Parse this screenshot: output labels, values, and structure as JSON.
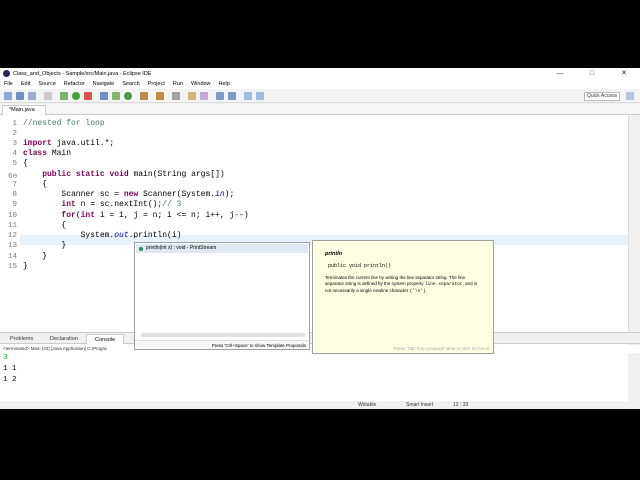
{
  "window": {
    "title": "Class_and_Objects - Sample/src/Main.java - Eclipse IDE",
    "minimize": "—",
    "maximize": "□",
    "close": "✕"
  },
  "menu": [
    "File",
    "Edit",
    "Source",
    "Refactor",
    "Navigate",
    "Search",
    "Project",
    "Run",
    "Window",
    "Help"
  ],
  "toolbar": {
    "quick_access": "Quick Access"
  },
  "editor": {
    "tab_label": "*Main.java",
    "lines": [
      {
        "no": "1",
        "text": "//nested for loop"
      },
      {
        "no": "2",
        "text": ""
      },
      {
        "no": "3",
        "text": "import java.util.*;"
      },
      {
        "no": "4",
        "text": "class Main"
      },
      {
        "no": "5",
        "text": "{"
      },
      {
        "no": "6⊖",
        "text": "    public static void main(String args[])"
      },
      {
        "no": "7",
        "text": "    {"
      },
      {
        "no": "8",
        "text": "        Scanner sc = new Scanner(System.in);"
      },
      {
        "no": "9",
        "text": "        int n = sc.nextInt();// 3"
      },
      {
        "no": "10",
        "text": "        for(int i = 1, j = n; i <= n; i++, j--)"
      },
      {
        "no": "11",
        "text": "        {"
      },
      {
        "no": "12",
        "text": "            System.out.println(i)"
      },
      {
        "no": "13",
        "text": "        }"
      },
      {
        "no": "14",
        "text": "    }"
      },
      {
        "no": "15",
        "text": "}"
      }
    ]
  },
  "proposals": {
    "selected": "println(int x) : void - PrintStream",
    "footer": "Press 'Ctrl+Space' to show Template Proposals"
  },
  "javadoc": {
    "title": "println",
    "signature": "public void println()",
    "desc_1": "Terminates the current line by writing the line separator string. The line separator string is defined by the system property",
    "desc_prop": "line.separator",
    "desc_2": ", and is not necessarily a single newline character",
    "desc_char": "('\\n')",
    "desc_end": ".",
    "footer": "Press 'Tab' from proposal table or click for focus"
  },
  "console": {
    "tabs": [
      "Problems",
      "Declaration",
      "Console"
    ],
    "active_tab": "Console",
    "status": "<terminated> Main (33) [Java Application] C:\\Progra",
    "output": [
      {
        "text": "3",
        "input": true
      },
      {
        "text": "1 1",
        "input": false
      },
      {
        "text": "1 2",
        "input": false
      }
    ]
  },
  "statusbar": {
    "writable": "Writable",
    "insert_mode": "Smart Insert",
    "position": "12 : 33"
  },
  "colors": {
    "keyword": "#7f0055",
    "comment": "#3f7f5f",
    "field": "#0000c0",
    "javadoc_bg": "#ffffe1",
    "console_input": "#00c800"
  }
}
